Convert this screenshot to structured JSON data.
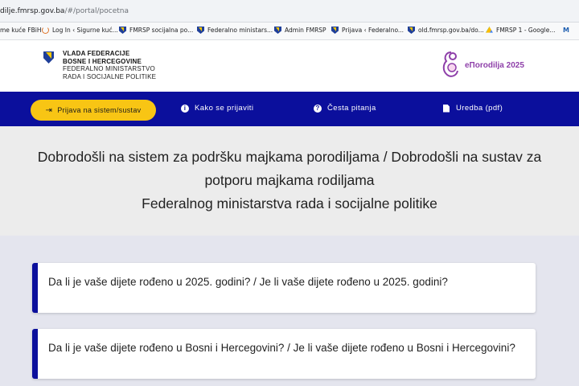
{
  "browser": {
    "url_main": "dilje.fmrsp.gov.ba",
    "url_path": "/#/portal/pocetna",
    "bookmarks": [
      {
        "label": "me kuće FBiH",
        "icon": "none"
      },
      {
        "label": "Log In ‹ Sigurne kuć...",
        "icon": "reload-icon"
      },
      {
        "label": "FMRSP socijalna po...",
        "icon": "shield-icon"
      },
      {
        "label": "Federalno ministars...",
        "icon": "shield-icon"
      },
      {
        "label": "Admin FMRSP",
        "icon": "shield-icon"
      },
      {
        "label": "Prijava ‹ Federalno...",
        "icon": "shield-icon"
      },
      {
        "label": "old.fmrsp.gov.ba/do...",
        "icon": "shield-icon"
      },
      {
        "label": "FMRSP 1 - Google...",
        "icon": "drive-icon"
      },
      {
        "label": "M",
        "icon": "ms-icon"
      }
    ]
  },
  "header": {
    "gov_line1": "VLADA FEDERACIJE",
    "gov_line2": "BOSNE I HERCEGOVINE",
    "gov_line3": "FEDERALNO MINISTARSTVO",
    "gov_line4": "RADA I SOCIJALNE POLITIKE",
    "app_name": "eПorodilja 2025"
  },
  "nav": {
    "login": "Prijava na sistem/sustav",
    "how_to": "Kako se prijaviti",
    "faq": "Česta pitanja",
    "regulation": "Uredba (pdf)"
  },
  "welcome": {
    "line1": "Dobrodošli na sistem za podršku majkama porodiljama / Dobrodošli na sustav za",
    "line2": "potporu majkama rodiljama",
    "line3": "Federalnog ministarstva rada i socijalne politike"
  },
  "questions": [
    "Da li je vaše dijete rođeno u 2025. godini? / Je li vaše dijete rođeno u 2025. godini?",
    "Da li je vaše dijete rođeno u Bosni i Hercegovini? / Je li vaše dijete rođeno u Bosni i Hercegovini?"
  ],
  "colors": {
    "nav_bg": "#0b0f9c",
    "accent_yellow": "#f8c514",
    "brand_purple": "#8e3fa9"
  }
}
